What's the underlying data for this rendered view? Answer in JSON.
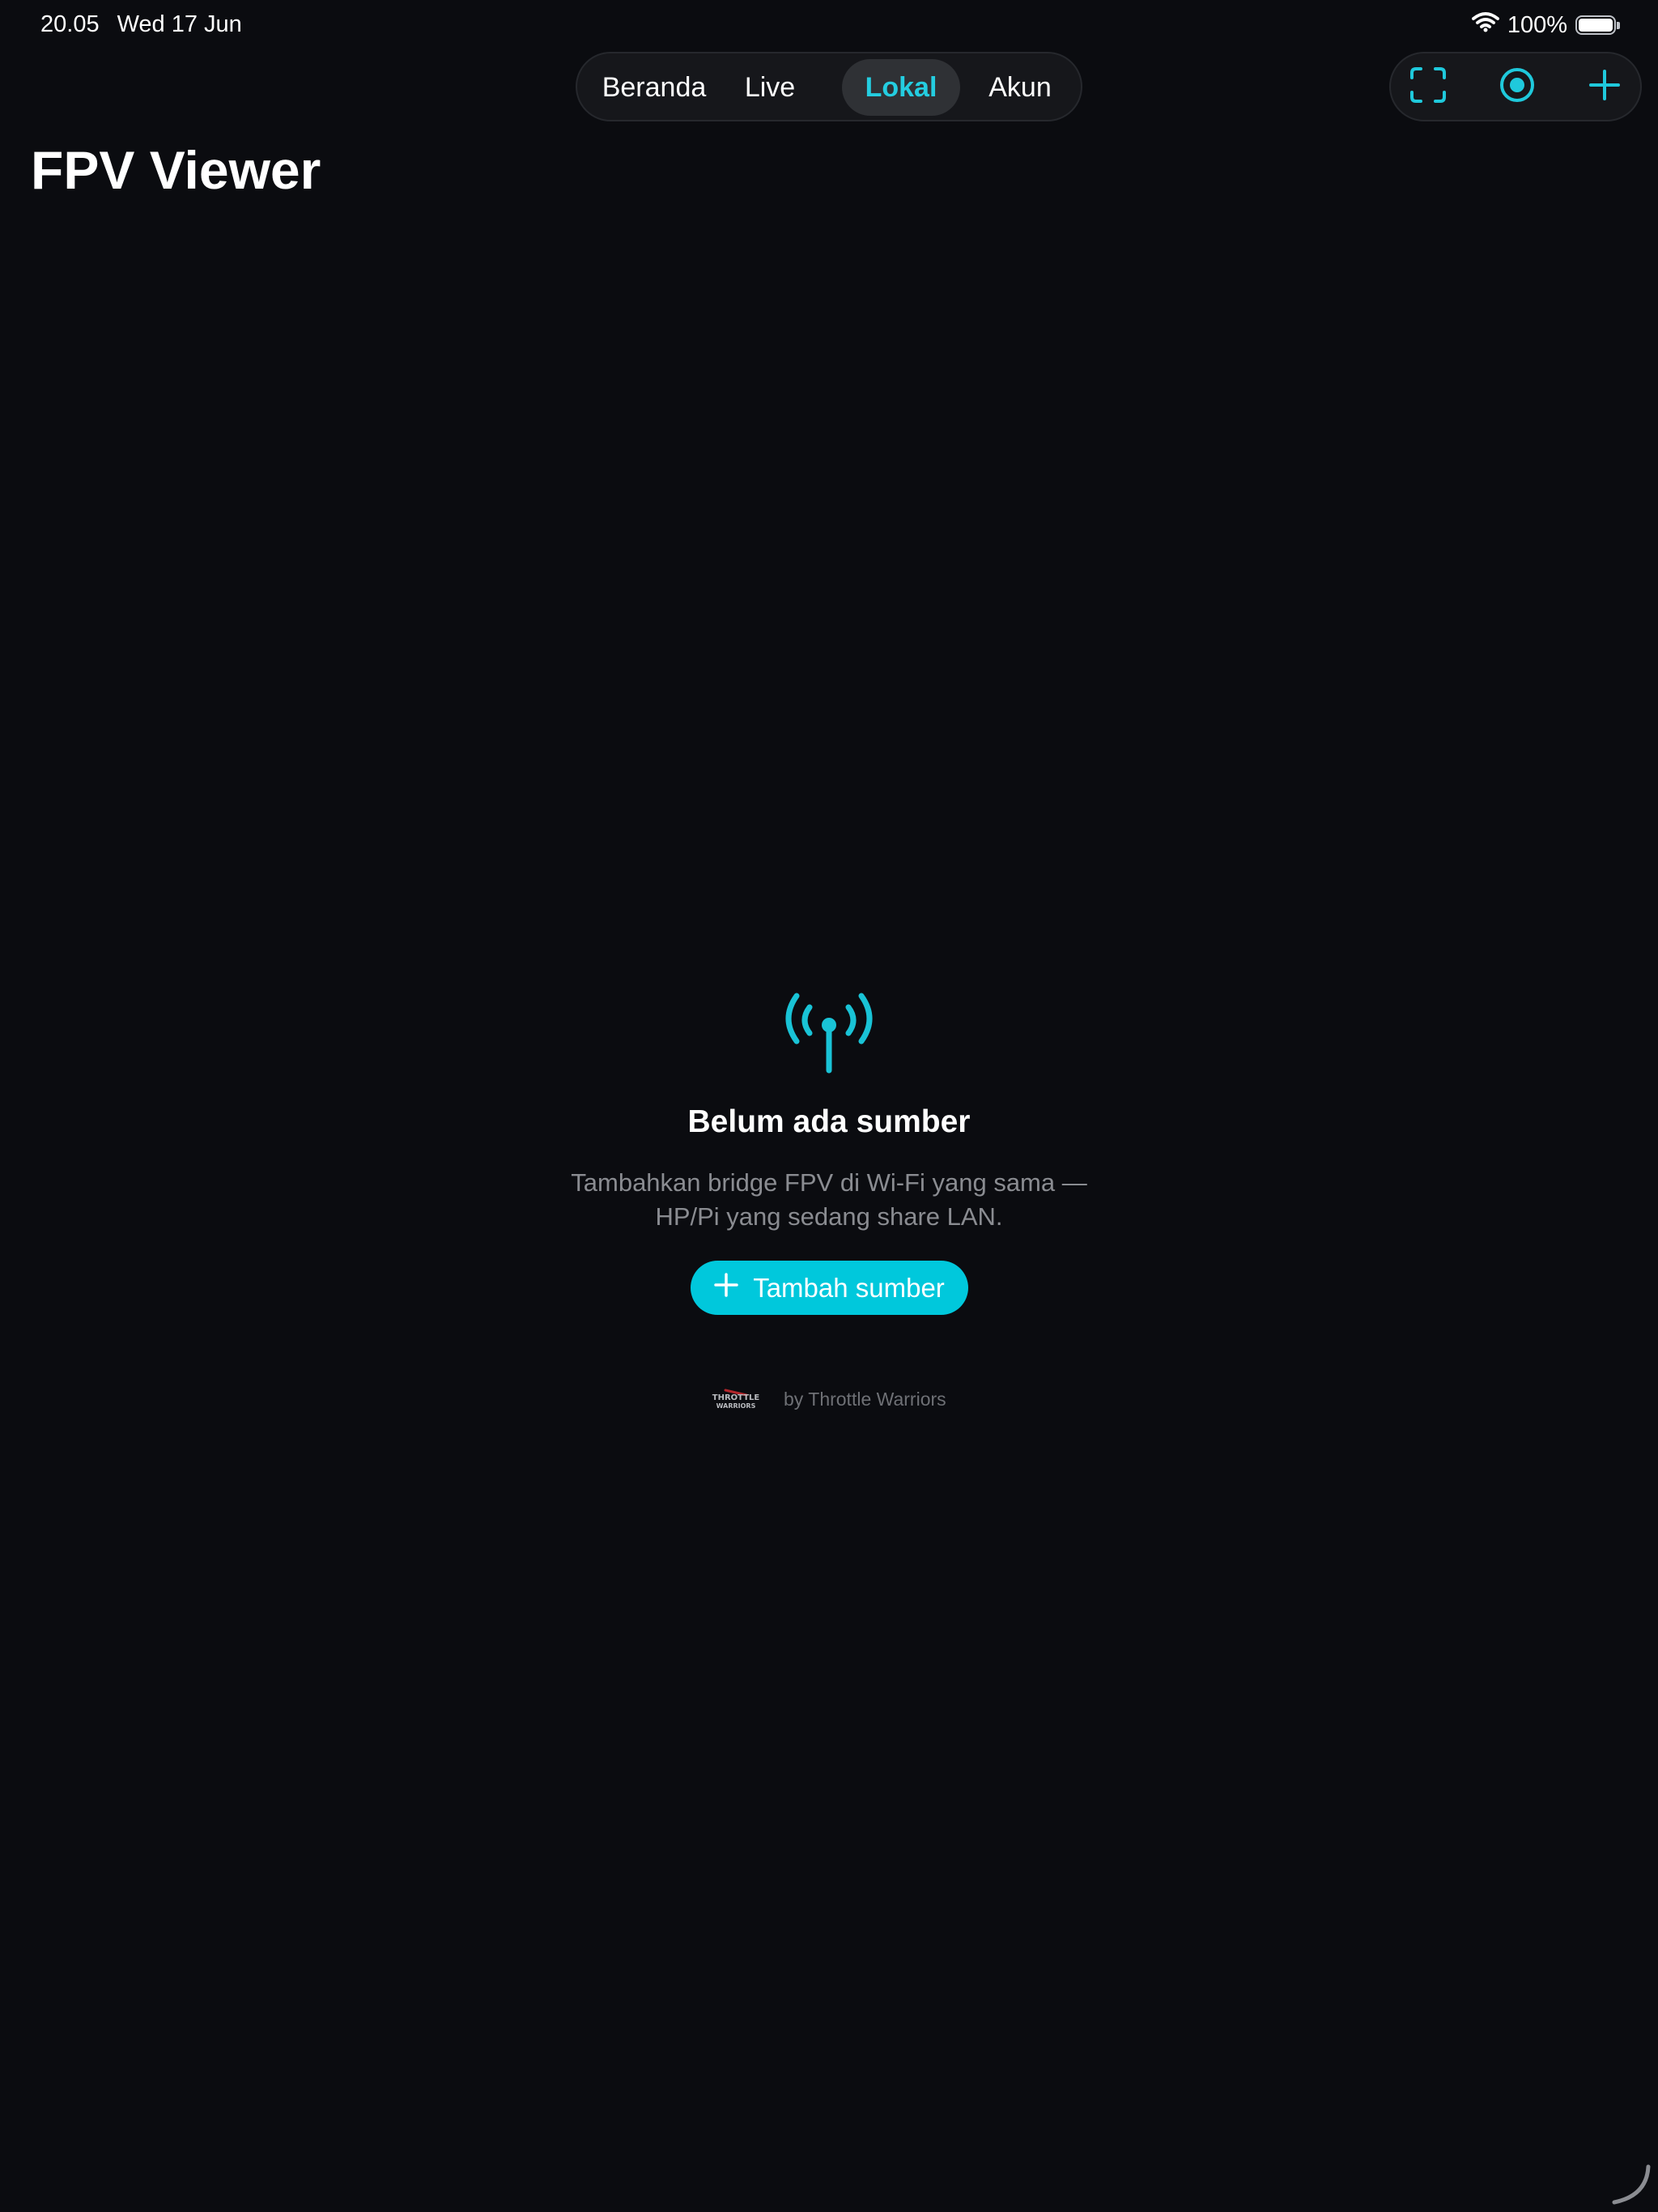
{
  "status_bar": {
    "time": "20.05",
    "date": "Wed 17 Jun",
    "battery": "100%",
    "wifi_icon": "wifi-icon",
    "battery_icon": "battery-icon"
  },
  "tabs": [
    {
      "label": "Beranda",
      "active": false
    },
    {
      "label": "Live",
      "active": false
    },
    {
      "label": "Lokal",
      "active": true
    },
    {
      "label": "Akun",
      "active": false
    }
  ],
  "actions": [
    {
      "icon": "scan-frame-icon"
    },
    {
      "icon": "record-icon"
    },
    {
      "icon": "plus-icon"
    }
  ],
  "page": {
    "title": "FPV Viewer"
  },
  "empty_state": {
    "icon": "antenna-broadcast-icon",
    "title": "Belum ada sumber",
    "description_line1": "Tambahkan bridge FPV di Wi-Fi yang sama —",
    "description_line2": "HP/Pi yang sedang share LAN.",
    "button_label": "Tambah sumber"
  },
  "branding": {
    "logo_text": "THROTTLE WARRIORS",
    "text": "by Throttle Warriors"
  },
  "colors": {
    "background": "#0b0c10",
    "accent": "#00c8dc",
    "active_tab_text": "#24cde0",
    "muted_text": "#8a8c91"
  }
}
